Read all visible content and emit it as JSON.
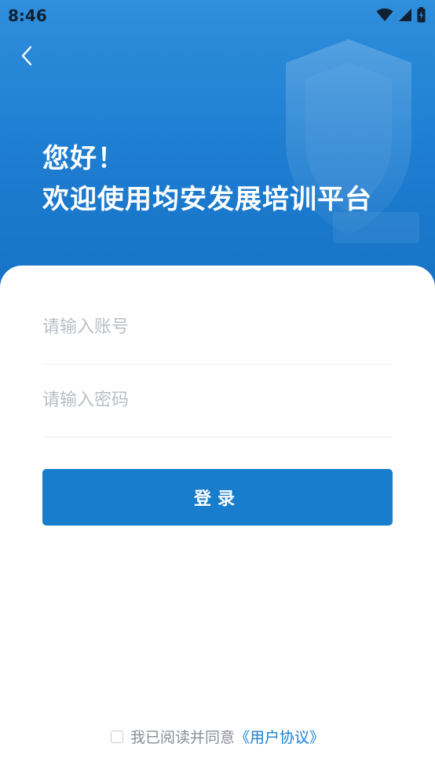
{
  "status_bar": {
    "time": "8:46"
  },
  "header": {
    "greeting_line1": "您好！",
    "greeting_line2": "欢迎使用均安发展培训平台"
  },
  "form": {
    "account_placeholder": "请输入账号",
    "password_placeholder": "请输入密码",
    "login_label": "登录"
  },
  "agreement": {
    "text": "我已阅读并同意",
    "link_text": "《用户协议》",
    "checked": false
  },
  "colors": {
    "primary": "#177dcc",
    "header_bg": "#1f7fd2",
    "link": "#1b7fcf",
    "placeholder": "#b8bec6"
  },
  "icons": {
    "back": "chevron-left-icon",
    "wifi": "wifi-icon",
    "signal": "cell-signal-icon",
    "battery": "battery-icon"
  }
}
